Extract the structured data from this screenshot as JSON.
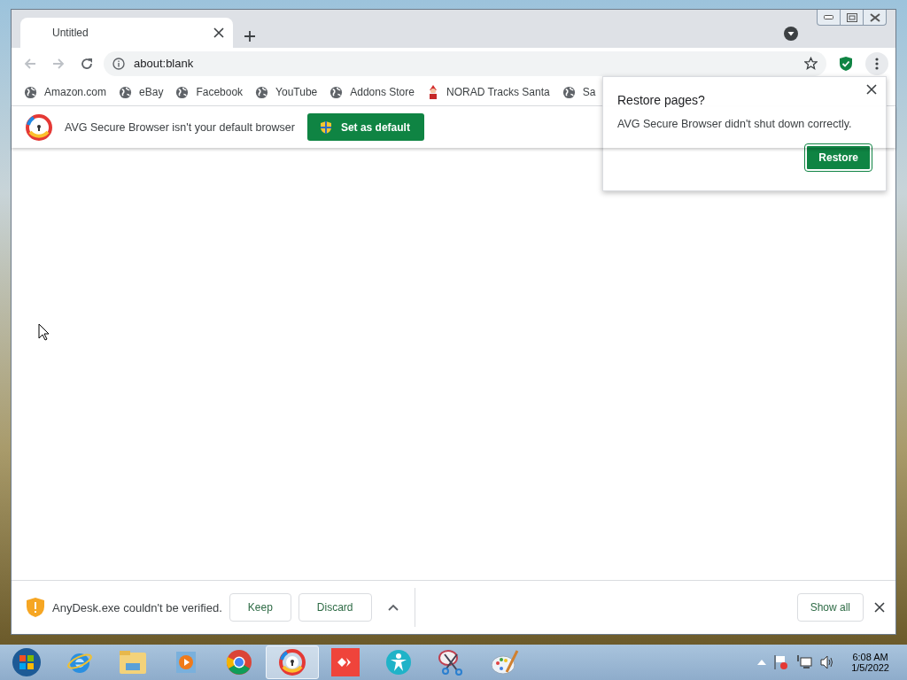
{
  "tabs": [
    {
      "title": "Untitled",
      "selected": true
    }
  ],
  "nav_buttons": [
    {
      "kind": "back",
      "disabled": true
    },
    {
      "kind": "forward",
      "disabled": true
    },
    {
      "kind": "reload",
      "disabled": false
    }
  ],
  "address_bar": {
    "value": "about:blank"
  },
  "bookmarks": [
    {
      "label": "Amazon.com",
      "kind": "globe"
    },
    {
      "label": "eBay",
      "kind": "globe"
    },
    {
      "label": "Facebook",
      "kind": "globe"
    },
    {
      "label": "YouTube",
      "kind": "globe"
    },
    {
      "label": "Addons Store",
      "kind": "globe"
    },
    {
      "label": "NORAD Tracks Santa",
      "kind": "santa"
    },
    {
      "label": "Sa",
      "kind": "globe"
    }
  ],
  "infobar": {
    "message": "AVG Secure Browser isn't your default browser",
    "button": "Set as default"
  },
  "restore_popup": {
    "title": "Restore pages?",
    "message": "AVG Secure Browser didn't shut down correctly.",
    "button": "Restore"
  },
  "download_bar": {
    "message": "AnyDesk.exe couldn't be verified.",
    "buttons": [
      "Keep",
      "Discard"
    ],
    "show_all": "Show all"
  },
  "taskbar": {
    "apps": [
      {
        "kind": "start",
        "selected": false
      },
      {
        "kind": "ie",
        "selected": false
      },
      {
        "kind": "folder",
        "selected": false
      },
      {
        "kind": "media",
        "selected": false
      },
      {
        "kind": "chrome",
        "selected": false
      },
      {
        "kind": "avg",
        "selected": true
      },
      {
        "kind": "anydesk",
        "selected": false
      },
      {
        "kind": "person",
        "selected": false
      },
      {
        "kind": "scissors",
        "selected": false
      },
      {
        "kind": "paint",
        "selected": false
      }
    ],
    "clock": {
      "time": "6:08 AM",
      "date": "1/5/2022"
    }
  }
}
